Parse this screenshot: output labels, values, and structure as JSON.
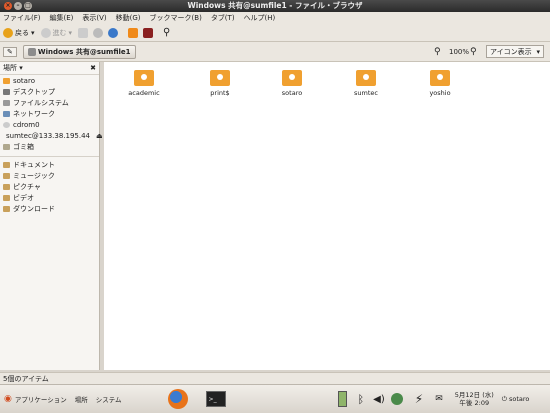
{
  "window": {
    "title": "Windows 共有@sumfile1 - ファイル・ブラウザ"
  },
  "menubar": [
    "ファイル(F)",
    "編集(E)",
    "表示(V)",
    "移動(G)",
    "ブックマーク(B)",
    "タブ(T)",
    "ヘルプ(H)"
  ],
  "toolbar": {
    "back_label": "戻る",
    "forward_label": "進む"
  },
  "location": {
    "path_label": "Windows 共有@sumfile1",
    "zoom": "100%",
    "view_mode": "アイコン表示"
  },
  "sidebar": {
    "header": "場所",
    "places": [
      "sotaro",
      "デスクトップ",
      "ファイルシステム",
      "ネットワーク",
      "cdrom0",
      "sumtec@133.38.195.44",
      "ゴミ箱"
    ],
    "bookmarks": [
      "ドキュメント",
      "ミュージック",
      "ピクチャ",
      "ビデオ",
      "ダウンロード"
    ]
  },
  "folders": [
    "academic",
    "print$",
    "sotaro",
    "sumtec",
    "yoshio"
  ],
  "status": "5個のアイテム",
  "panel": {
    "apps": "アプリケーション",
    "places": "場所",
    "system": "システム",
    "date": "5月12日 (水)",
    "time": "午後 2:09",
    "user": "sotaro"
  },
  "colors": {
    "folder": "#f0a030",
    "title_bg": "#3a3a3a"
  }
}
